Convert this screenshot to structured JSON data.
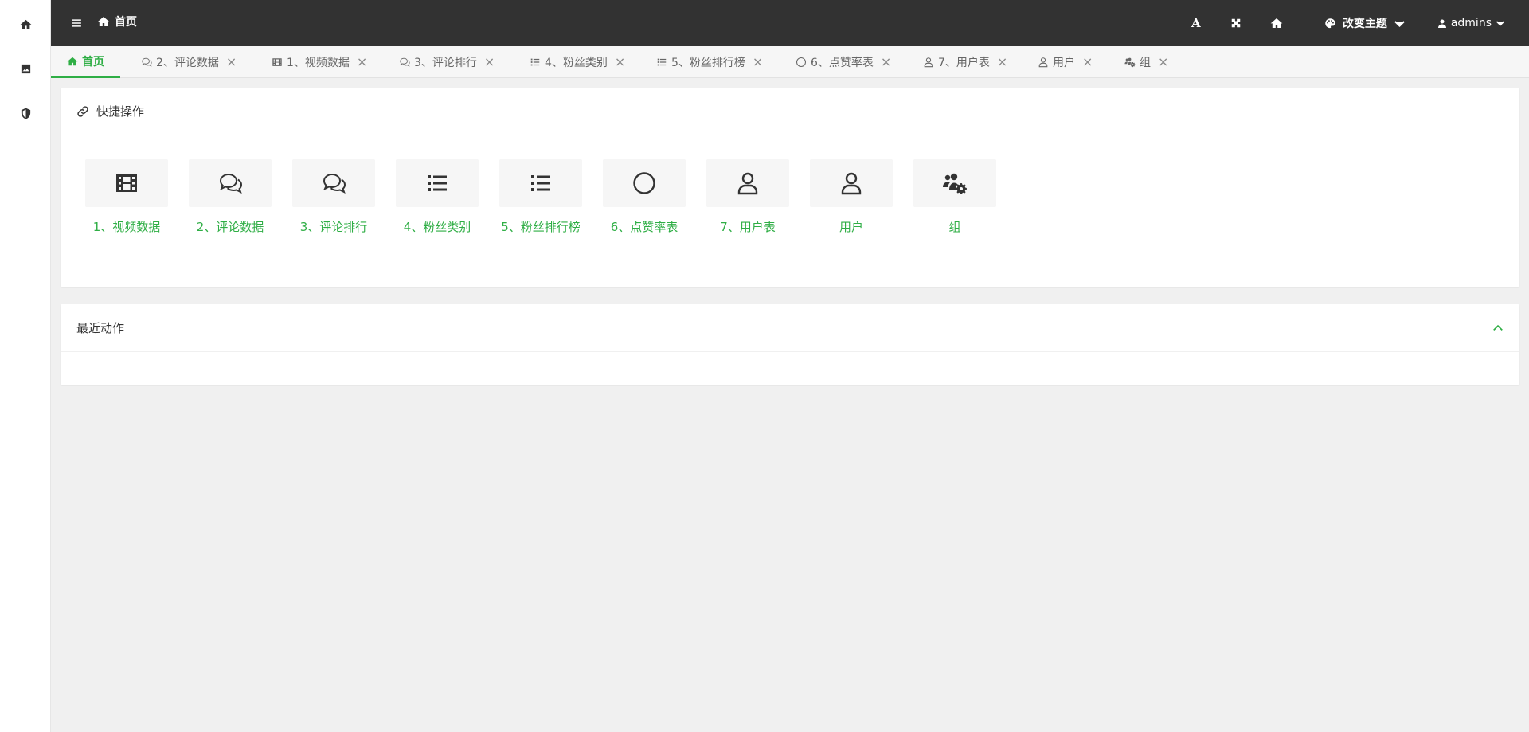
{
  "colors": {
    "accent": "#2fae45",
    "topbar": "#323232",
    "background": "#f0f0f0"
  },
  "rail": {
    "items": [
      {
        "icon": "home-icon"
      },
      {
        "icon": "image-icon"
      },
      {
        "icon": "shield-icon"
      }
    ]
  },
  "topbar": {
    "menu_icon": "hamburger-icon",
    "breadcrumb": "首页",
    "tools": {
      "font": "A",
      "grid_icon": "puzzle-icon",
      "home_icon": "home-icon",
      "theme_label": "改变主题",
      "user_label": "admins"
    }
  },
  "tabs": [
    {
      "label": "首页",
      "icon": "home-icon",
      "active": true,
      "closable": false
    },
    {
      "label": "2、评论数据",
      "icon": "comments-icon",
      "closable": true
    },
    {
      "label": "1、视频数据",
      "icon": "film-icon",
      "closable": true
    },
    {
      "label": "3、评论排行",
      "icon": "comments-icon",
      "closable": true
    },
    {
      "label": "4、粉丝类别",
      "icon": "list-icon",
      "closable": true
    },
    {
      "label": "5、粉丝排行榜",
      "icon": "list-icon",
      "closable": true
    },
    {
      "label": "6、点赞率表",
      "icon": "circle-icon",
      "closable": true
    },
    {
      "label": "7、用户表",
      "icon": "user-icon",
      "closable": true
    },
    {
      "label": "用户",
      "icon": "user-icon",
      "closable": true
    },
    {
      "label": "组",
      "icon": "users-cog-icon",
      "closable": true
    }
  ],
  "tab_close_glyph": "×",
  "quick": {
    "title": "快捷操作",
    "items": [
      {
        "label": "1、视频数据",
        "icon": "film-icon"
      },
      {
        "label": "2、评论数据",
        "icon": "comments-icon"
      },
      {
        "label": "3、评论排行",
        "icon": "comments-icon"
      },
      {
        "label": "4、粉丝类别",
        "icon": "list-icon"
      },
      {
        "label": "5、粉丝排行榜",
        "icon": "list-icon"
      },
      {
        "label": "6、点赞率表",
        "icon": "circle-icon"
      },
      {
        "label": "7、用户表",
        "icon": "user-icon"
      },
      {
        "label": "用户",
        "icon": "user-icon"
      },
      {
        "label": "组",
        "icon": "users-cog-icon"
      }
    ]
  },
  "recent": {
    "title": "最近动作"
  }
}
